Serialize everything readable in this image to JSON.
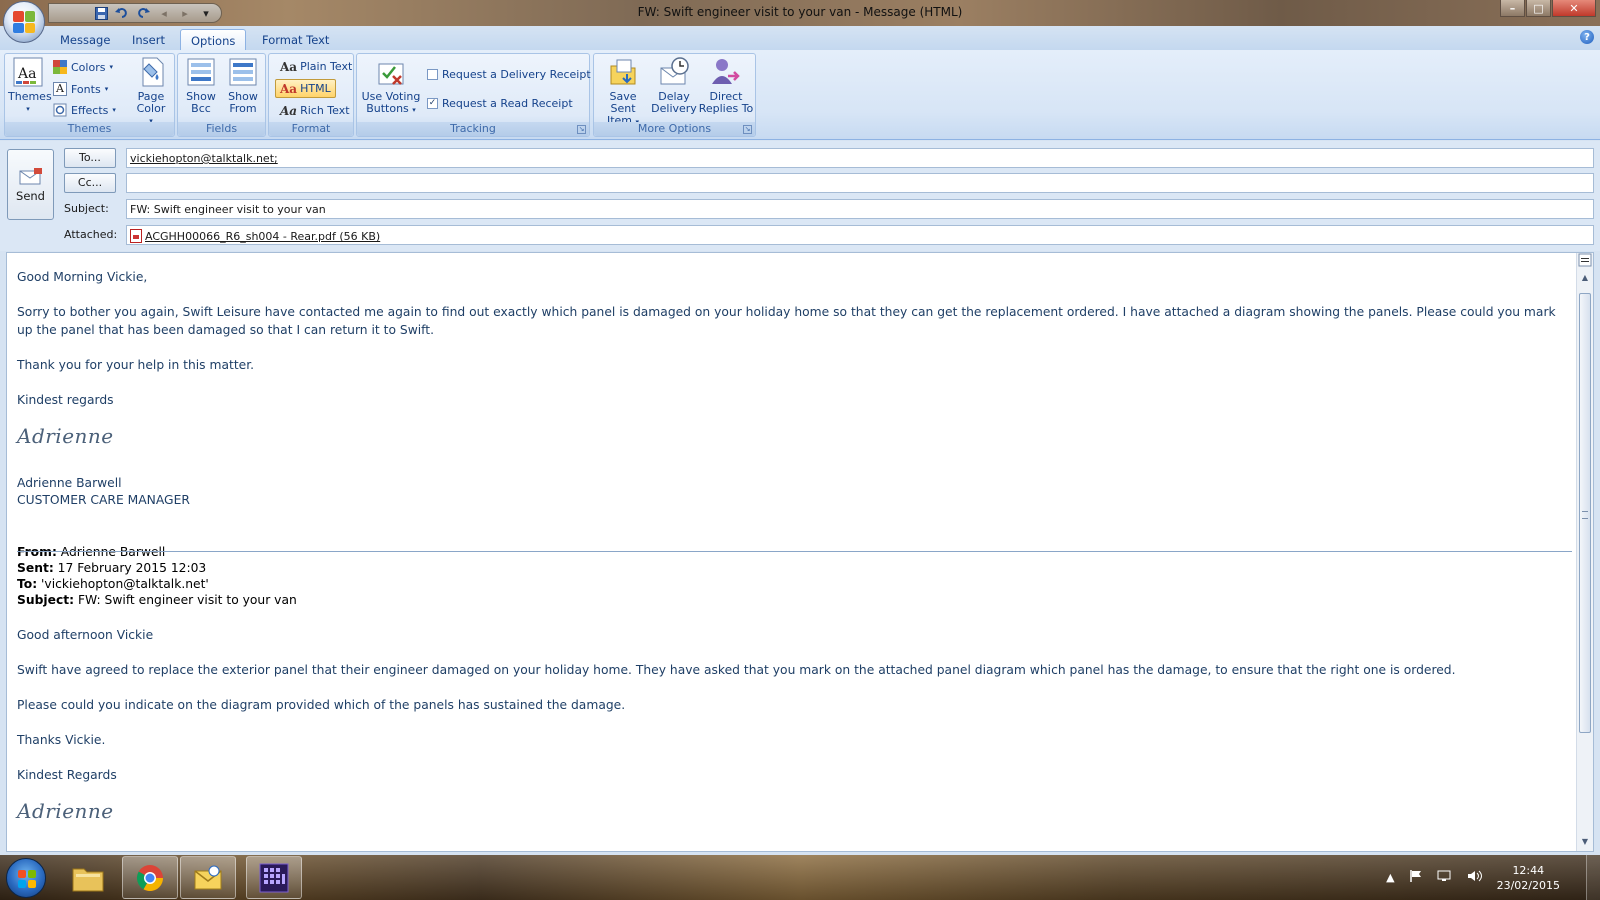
{
  "window": {
    "title": "FW: Swift engineer visit to your van - Message (HTML)",
    "controls": {
      "minimize": "–",
      "maximize": "□",
      "close": "✕"
    }
  },
  "quick_access": {
    "save_icon": "save-icon",
    "undo_icon": "undo-icon",
    "redo_icon": "redo-icon",
    "customize": "▾"
  },
  "tabs": [
    {
      "label": "Message"
    },
    {
      "label": "Insert"
    },
    {
      "label": "Options"
    },
    {
      "label": "Format Text"
    }
  ],
  "ribbon": {
    "themes": {
      "group": "Themes",
      "themes_label": "Themes",
      "colors": "Colors",
      "fonts": "Fonts",
      "effects": "Effects",
      "page_color": "Page Color"
    },
    "fields": {
      "group": "Fields",
      "show_bcc_1": "Show",
      "show_bcc_2": "Bcc",
      "show_from_1": "Show",
      "show_from_2": "From"
    },
    "format": {
      "group": "Format",
      "plain": "Plain Text",
      "html": "HTML",
      "rich": "Rich Text",
      "selected": "HTML"
    },
    "tracking": {
      "group": "Tracking",
      "voting_1": "Use Voting",
      "voting_2": "Buttons",
      "delivery_receipt": "Request a Delivery Receipt",
      "delivery_checked": false,
      "read_receipt": "Request a Read Receipt",
      "read_checked": true
    },
    "more": {
      "group": "More Options",
      "save_sent_1": "Save Sent",
      "save_sent_2": "Item",
      "delay_1": "Delay",
      "delay_2": "Delivery",
      "direct_1": "Direct",
      "direct_2": "Replies To"
    }
  },
  "header": {
    "send": "Send",
    "to_button": "To...",
    "cc_button": "Cc...",
    "subject_label": "Subject:",
    "attached_label": "Attached:",
    "to_value": "vickiehopton@talktalk.net;",
    "cc_value": "",
    "subject_value": "FW: Swift engineer visit to your van",
    "attachment": "ACGHH00066_R6_sh004 - Rear.pdf (56 KB)"
  },
  "message": {
    "greeting": "Good Morning Vickie,",
    "para1": "Sorry to bother you again, Swift Leisure have contacted me again to find out exactly which panel is damaged on your holiday home so that they can get the replacement ordered.  I have attached a diagram showing the panels.  Please could you mark up the panel that has been damaged so that I can return it to Swift.",
    "para2": "Thank you for your help in this matter.",
    "closing": "Kindest regards",
    "signature": "Adrienne",
    "sig_name": "Adrienne Barwell",
    "sig_title": "CUSTOMER CARE MANAGER",
    "forwarded": {
      "from_label": "From:",
      "from": " Adrienne Barwell",
      "sent_label": "Sent:",
      "sent": " 17 February 2015 12:03",
      "to_label": "To:",
      "to": " 'vickiehopton@talktalk.net'",
      "subject_label": "Subject:",
      "subject": " FW: Swift engineer visit to your van",
      "greeting": "Good afternoon Vickie",
      "para1": "Swift have agreed to replace the exterior panel that their engineer damaged on your holiday home.  They have asked that you mark on the attached panel diagram which panel has the damage, to ensure that the right one is ordered.",
      "para2": "Please could you indicate on the diagram provided which of the panels has sustained the damage.",
      "thanks": "Thanks Vickie.",
      "closing": "Kindest Regards",
      "signature": "Adrienne"
    }
  },
  "taskbar": {
    "apps": [
      "explorer-icon",
      "chrome-icon",
      "outlook-icon",
      "app-grid-icon"
    ],
    "time": "12:44",
    "date": "23/02/2015"
  }
}
